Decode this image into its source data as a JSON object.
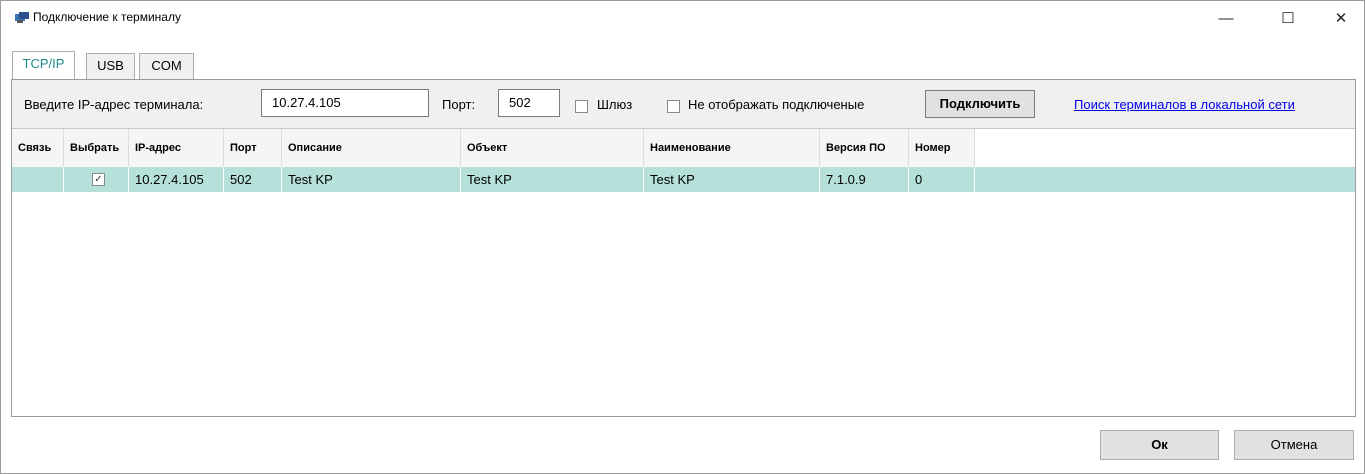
{
  "window": {
    "title": "Подключение к терминалу",
    "minimize_glyph": "—",
    "maximize_glyph": "☐",
    "close_glyph": "✕",
    "app_icon": "terminal-icon"
  },
  "tabs": [
    {
      "label": "TCP/IP",
      "active": true
    },
    {
      "label": "USB",
      "active": false
    },
    {
      "label": "COM",
      "active": false
    }
  ],
  "toolbar": {
    "ip_label": "Введите IP-адрес терминала:",
    "ip_value": "10.27.4.105",
    "port_label": "Порт:",
    "port_value": "502",
    "gateway_label": "Шлюз",
    "gateway_checked": false,
    "hide_connected_label": "Не отображать подключеные",
    "hide_connected_checked": false,
    "connect_label": "Подключить",
    "search_link": "Поиск терминалов в локальной сети"
  },
  "grid": {
    "columns": [
      "Связь",
      "Выбрать",
      "IP-адрес",
      "Порт",
      "Описание",
      "Объект",
      "Наименование",
      "Версия ПО",
      "Номер"
    ],
    "rows": [
      {
        "link": "",
        "selected": true,
        "check_glyph": "✓",
        "ip": "10.27.4.105",
        "port": "502",
        "description": "Test KP",
        "object": "Test KP",
        "name": "Test KP",
        "version": "7.1.0.9",
        "number": "0"
      }
    ]
  },
  "footer": {
    "ok_label": "Ок",
    "cancel_label": "Отмена"
  },
  "colors": {
    "selected_row": "#b6e0da",
    "active_tab_text": "#1e8a8a",
    "link": "#0000ee"
  }
}
